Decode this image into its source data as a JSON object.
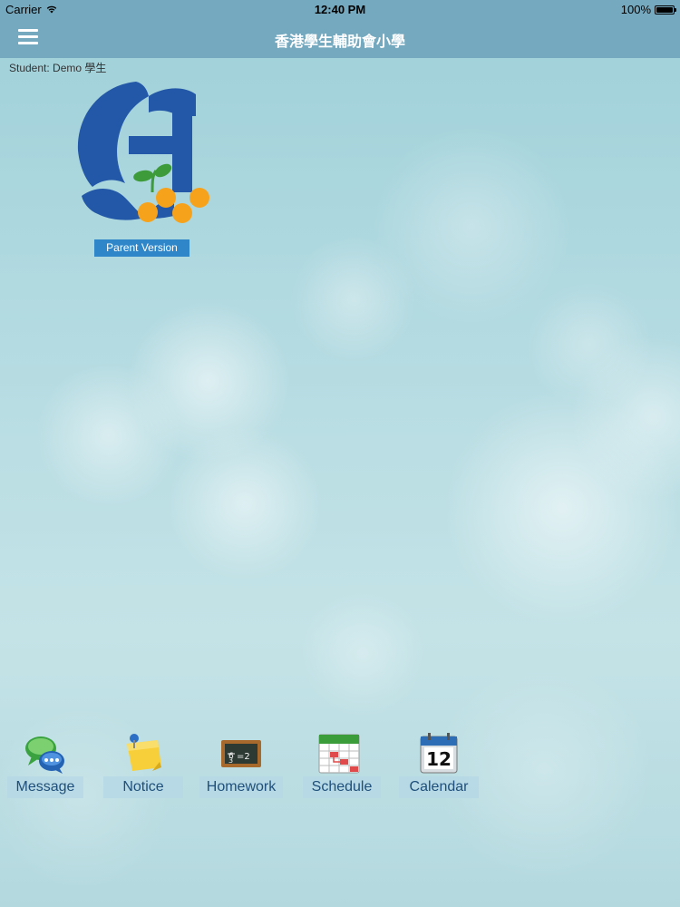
{
  "status_bar": {
    "carrier": "Carrier",
    "time": "12:40 PM",
    "battery": "100%"
  },
  "nav": {
    "title": "香港學生輔助會小學",
    "menu_icon": "hamburger-menu-icon"
  },
  "student_label": "Student: Demo 學生",
  "logo": {
    "icon": "school-logo",
    "version_label": "Parent Version"
  },
  "dock": {
    "items": [
      {
        "label": "Message",
        "icon": "message-bubbles-icon"
      },
      {
        "label": "Notice",
        "icon": "sticky-note-pin-icon"
      },
      {
        "label": "Homework",
        "icon": "blackboard-icon"
      },
      {
        "label": "Schedule",
        "icon": "schedule-calendar-icon"
      },
      {
        "label": "Calendar",
        "icon": "calendar-12-icon"
      }
    ]
  },
  "colors": {
    "nav_bg": "#75a9bf",
    "logo_blue": "#2357a8",
    "logo_orange": "#f7a21b",
    "logo_green": "#3e9b3a",
    "badge_blue": "#2f86c8",
    "dock_label_text": "#1f4f7a"
  }
}
